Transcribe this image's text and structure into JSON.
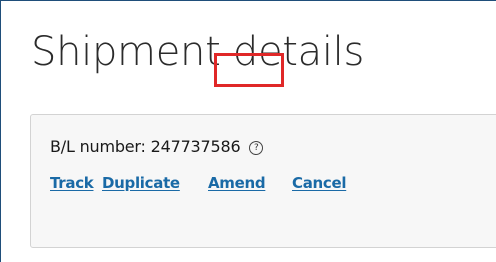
{
  "page": {
    "title": "Shipment details"
  },
  "shipment": {
    "bl_label": "B/L number:",
    "bl_number": "247737586",
    "help_icon": "question-circle-icon",
    "help_glyph": "?"
  },
  "actions": {
    "track": "Track",
    "duplicate": "Duplicate",
    "amend": "Amend",
    "cancel": "Cancel"
  },
  "colors": {
    "link": "#1a6aa6",
    "highlight": "#e02828",
    "panel_bg": "#f7f7f7",
    "frame_border": "#1f4e7a"
  }
}
